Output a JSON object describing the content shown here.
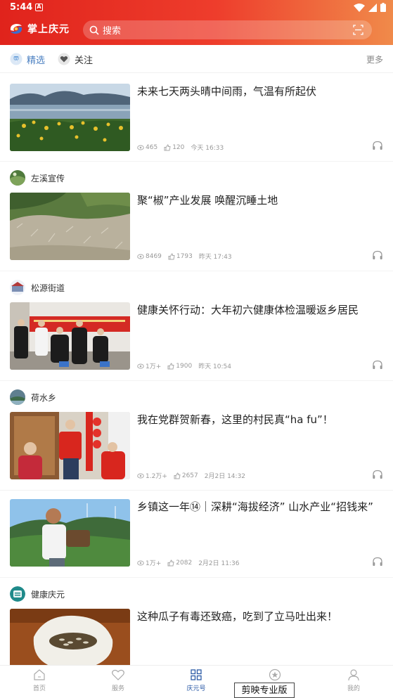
{
  "status_bar": {
    "time": "5:44",
    "notice_letter": "A"
  },
  "header": {
    "app_title": "掌上庆元",
    "search_placeholder": "搜索"
  },
  "tabs": {
    "featured": "精选",
    "following": "关注",
    "more": "更多"
  },
  "feed": [
    {
      "source": "",
      "title": "未来七天两头晴中间雨，气温有所起伏",
      "views": "465",
      "likes": "120",
      "time": "今天 16:33",
      "image": "lake-landscape"
    },
    {
      "source": "左溪宣传",
      "title": "聚“椒”产业发展 唤醒沉睡土地",
      "views": "8469",
      "likes": "1793",
      "time": "昨天 17:43",
      "image": "hillside-farmland"
    },
    {
      "source": "松源街道",
      "title": " 健康关怀行动：大年初六健康体检温暖返乡居民",
      "views": "1万+",
      "likes": "1900",
      "time": "昨天 10:54",
      "image": "health-checkup"
    },
    {
      "source": "荷水乡",
      "title": "我在党群贺新春，这里的村民真“ha fu”！",
      "views": "1.2万+",
      "likes": "2657",
      "time": "2月2日 14:32",
      "image": "spring-couplets"
    },
    {
      "source": "",
      "title": "乡镇这一年⑭｜深耕“海拔经济” 山水产业“招钱来”",
      "views": "1万+",
      "likes": "2082",
      "time": "2月2日 11:36",
      "image": "mountain-farmer"
    },
    {
      "source": "健康庆元",
      "title": "这种瓜子有毒还致癌，吃到了立马吐出来！",
      "views": "",
      "likes": "",
      "time": "",
      "image": "sunflower-seeds"
    }
  ],
  "bottom_nav": [
    {
      "label": "首页",
      "icon": "home-icon"
    },
    {
      "label": "服务",
      "icon": "heart-icon"
    },
    {
      "label": "庆元号",
      "icon": "grid-icon"
    },
    {
      "label": "",
      "icon": "star-icon"
    },
    {
      "label": "我的",
      "icon": "user-icon"
    }
  ],
  "watermark": "剪映专业版",
  "colors": {
    "header_start": "#e0231c",
    "header_end": "#f08a4a",
    "tab_active": "#4a7fc1",
    "nav_active": "#2b5aa6"
  }
}
